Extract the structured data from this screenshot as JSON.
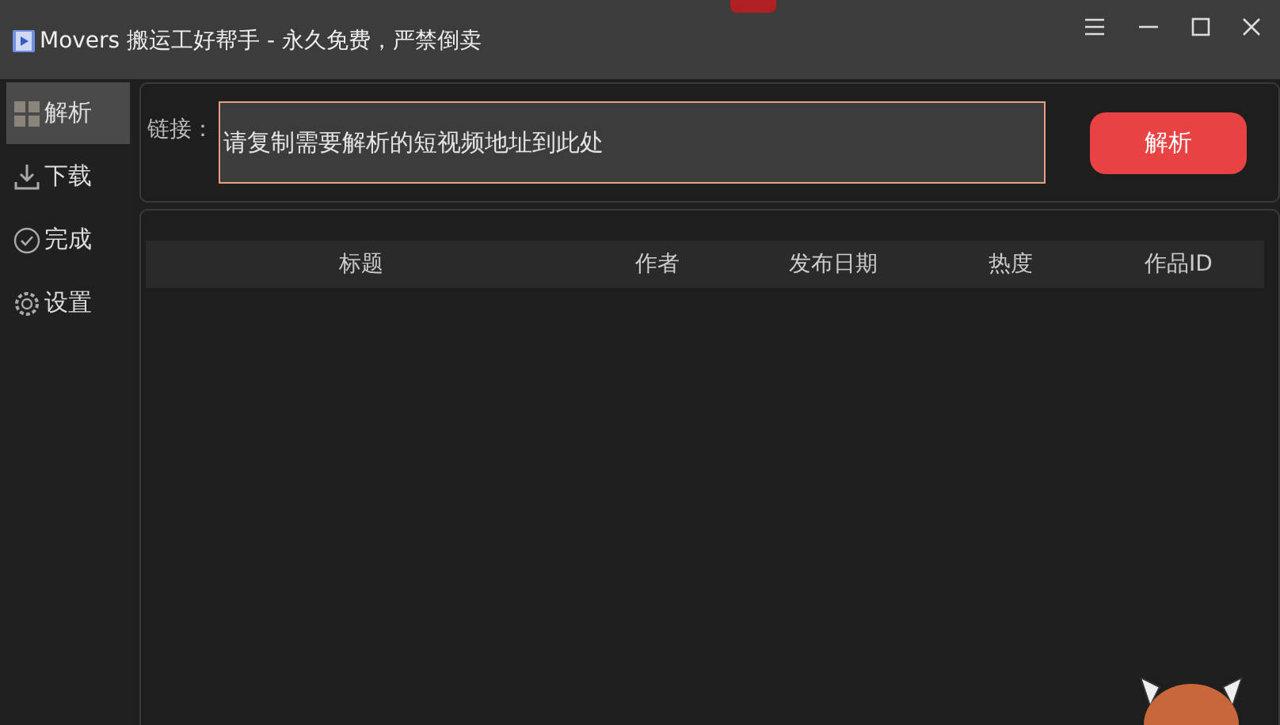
{
  "window": {
    "title": "Movers 搬运工好帮手 - 永久免费，严禁倒卖"
  },
  "sidebar": {
    "items": [
      {
        "label": "解析",
        "selected": true
      },
      {
        "label": "下载",
        "selected": false
      },
      {
        "label": "完成",
        "selected": false
      },
      {
        "label": "设置",
        "selected": false
      }
    ]
  },
  "link_bar": {
    "label": "链接：",
    "placeholder": "请复制需要解析的短视频地址到此处",
    "button": "解析"
  },
  "table": {
    "columns": [
      "标题",
      "作者",
      "发布日期",
      "热度",
      "作品ID"
    ]
  }
}
